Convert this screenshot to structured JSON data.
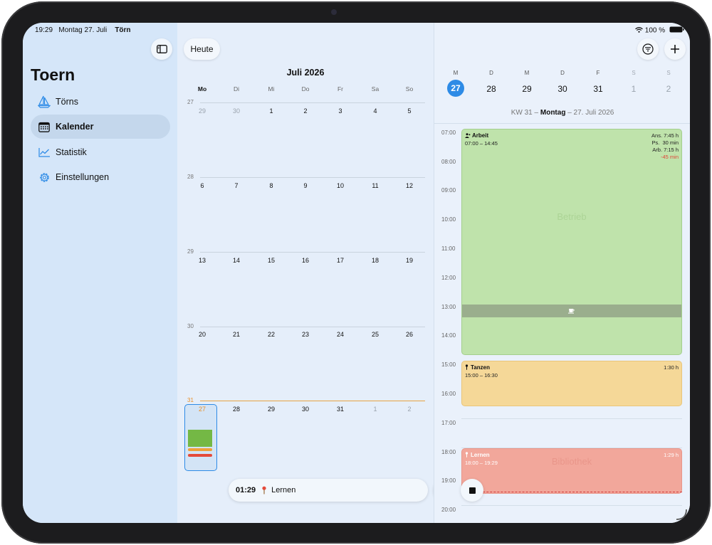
{
  "status_bar": {
    "time": "19:29",
    "date": "Montag 27. Juli",
    "app": "Törn",
    "battery": "100 %"
  },
  "sidebar": {
    "app_title": "Toern",
    "items": [
      {
        "label": "Törns",
        "icon": "sailboat-icon",
        "active": false
      },
      {
        "label": "Kalender",
        "icon": "calendar-icon",
        "active": true
      },
      {
        "label": "Statistik",
        "icon": "chart-line-icon",
        "active": false
      },
      {
        "label": "Einstellungen",
        "icon": "gear-icon",
        "active": false
      }
    ]
  },
  "month_view": {
    "today_button": "Heute",
    "month_title": "Juli 2026",
    "weekdays": [
      "Mo",
      "Di",
      "Mi",
      "Do",
      "Fr",
      "Sa",
      "So"
    ],
    "weeks": [
      {
        "kw": "27",
        "days": [
          "29",
          "30",
          "1",
          "2",
          "3",
          "4",
          "5"
        ]
      },
      {
        "kw": "28",
        "days": [
          "6",
          "7",
          "8",
          "9",
          "10",
          "11",
          "12"
        ]
      },
      {
        "kw": "29",
        "days": [
          "13",
          "14",
          "15",
          "16",
          "17",
          "18",
          "19"
        ]
      },
      {
        "kw": "30",
        "days": [
          "20",
          "21",
          "22",
          "23",
          "24",
          "25",
          "26"
        ]
      },
      {
        "kw": "31",
        "days": [
          "27",
          "28",
          "29",
          "30",
          "31",
          "1",
          "2"
        ]
      }
    ],
    "accent": "#e8902a"
  },
  "timer": {
    "elapsed": "01:29",
    "label": "Lernen",
    "pin_icon": "pin-icon",
    "pause_icon": "pause-icon",
    "stop_icon": "stop-icon"
  },
  "day_view": {
    "week_letters": [
      "M",
      "D",
      "M",
      "D",
      "F",
      "S",
      "S"
    ],
    "week_days": [
      "27",
      "28",
      "29",
      "30",
      "31",
      "1",
      "2"
    ],
    "date_prefix": "KW 31 – ",
    "date_bold": "Montag",
    "date_suffix": " – 27. Juli 2026",
    "hours": [
      "07:00",
      "08:00",
      "09:00",
      "10:00",
      "11:00",
      "12:00",
      "13:00",
      "14:00",
      "15:00",
      "16:00",
      "17:00",
      "18:00",
      "19:00",
      "20:00"
    ],
    "events": [
      {
        "title": "Arbeit",
        "time": "07:00 – 14:45",
        "stats": [
          "Ans. 7:45 h",
          "Ps.  30 min",
          "Arb. 7:15 h"
        ],
        "diff": "-45 min",
        "watermark": "Betrieb",
        "color": "#bfe3ab",
        "icon": "person-icon"
      },
      {
        "title": "Tanzen",
        "time": "15:00 – 16:30",
        "duration": "1:30 h",
        "color": "#f5d898",
        "icon": "pin-icon"
      },
      {
        "title": "Lernen",
        "time": "18:00 – 19:29",
        "duration": "1:29 h",
        "watermark": "Bibliothek",
        "color": "#f2a79b",
        "icon": "pin-icon"
      }
    ],
    "pause_icon": "coffee-cup-icon",
    "colors": {
      "today": "#2e8be6",
      "negative": "#e0463a"
    }
  }
}
